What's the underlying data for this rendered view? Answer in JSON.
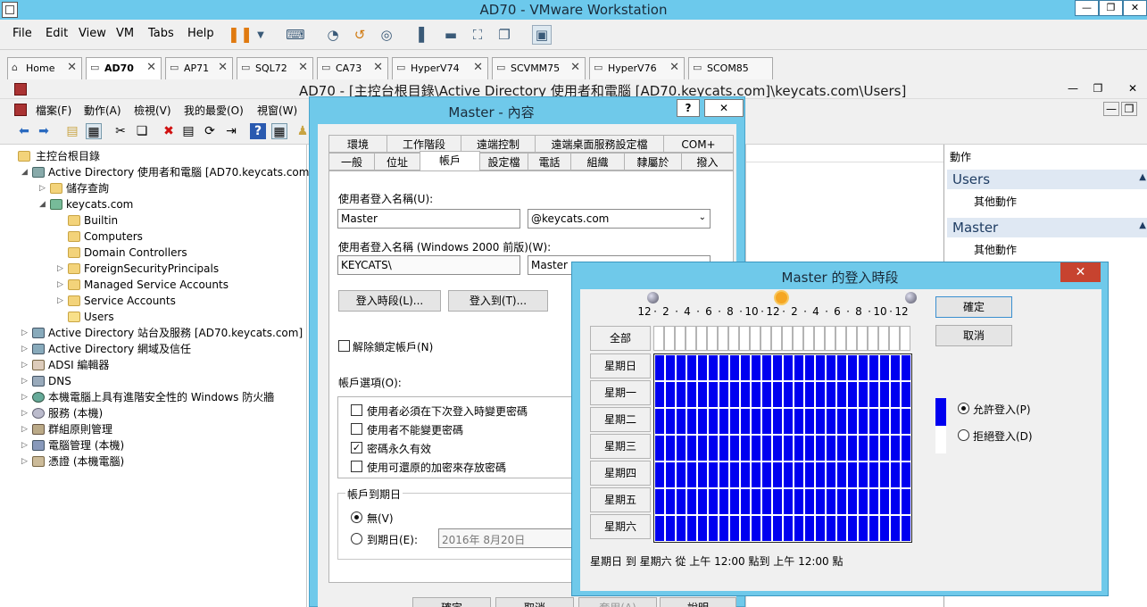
{
  "vmware": {
    "title": "AD70 - VMware Workstation",
    "menu": [
      "File",
      "Edit",
      "View",
      "VM",
      "Tabs",
      "Help"
    ],
    "tabs": [
      {
        "label": "Home",
        "icon": "home-icon",
        "active": false
      },
      {
        "label": "AD70",
        "icon": "vm-icon",
        "active": true
      },
      {
        "label": "AP71",
        "icon": "vm-icon",
        "active": false
      },
      {
        "label": "SQL72",
        "icon": "vm-icon",
        "active": false
      },
      {
        "label": "CA73",
        "icon": "vm-icon",
        "active": false
      },
      {
        "label": "HyperV74",
        "icon": "vm-icon",
        "active": false
      },
      {
        "label": "SCVMM75",
        "icon": "vm-icon",
        "active": false
      },
      {
        "label": "HyperV76",
        "icon": "vm-icon",
        "active": false
      },
      {
        "label": "SCOM85",
        "icon": "vm-icon",
        "active": false
      }
    ]
  },
  "mmc": {
    "title": "AD70 - [主控台根目錄\\Active Directory 使用者和電腦 [AD70.keycats.com]\\keycats.com\\Users]",
    "menu": [
      "檔案(F)",
      "動作(A)",
      "檢視(V)",
      "我的最愛(O)",
      "視窗(W)"
    ],
    "tree": [
      {
        "label": "主控台根目錄",
        "level": 0,
        "expander": ""
      },
      {
        "label": "Active Directory 使用者和電腦 [AD70.keycats.com]",
        "level": 1,
        "expander": "◢"
      },
      {
        "label": "儲存查詢",
        "level": 2,
        "expander": "▷"
      },
      {
        "label": "keycats.com",
        "level": 2,
        "expander": "◢"
      },
      {
        "label": "Builtin",
        "level": 3,
        "expander": ""
      },
      {
        "label": "Computers",
        "level": 3,
        "expander": ""
      },
      {
        "label": "Domain Controllers",
        "level": 3,
        "expander": ""
      },
      {
        "label": "ForeignSecurityPrincipals",
        "level": 3,
        "expander": "▷"
      },
      {
        "label": "Managed Service Accounts",
        "level": 3,
        "expander": "▷"
      },
      {
        "label": "Service Accounts",
        "level": 3,
        "expander": "▷"
      },
      {
        "label": "Users",
        "level": 3,
        "expander": ""
      },
      {
        "label": "Active Directory 站台及服務 [AD70.keycats.com]",
        "level": 0,
        "expander": "▷"
      },
      {
        "label": "Active Directory 網域及信任",
        "level": 0,
        "expander": "▷"
      },
      {
        "label": "ADSI 編輯器",
        "level": 0,
        "expander": "▷"
      },
      {
        "label": "DNS",
        "level": 0,
        "expander": "▷"
      },
      {
        "label": "本機電腦上具有進階安全性的 Windows 防火牆",
        "level": 0,
        "expander": "▷"
      },
      {
        "label": "服務 (本機)",
        "level": 0,
        "expander": "▷"
      },
      {
        "label": "群組原則管理",
        "level": 0,
        "expander": "▷"
      },
      {
        "label": "電腦管理 (本機)",
        "level": 0,
        "expander": "▷"
      },
      {
        "label": "憑證 (本機電腦)",
        "level": 0,
        "expander": "▷"
      }
    ],
    "actions": {
      "header": "動作",
      "sections": [
        {
          "title": "Users",
          "item": "其他動作"
        },
        {
          "title": "Master",
          "item": "其他動作"
        }
      ]
    }
  },
  "props": {
    "title": "Master - 內容",
    "help": "?",
    "close": "✕",
    "tabs_row1": [
      "環境",
      "工作階段",
      "遠端控制",
      "遠端桌面服務設定檔",
      "COM+"
    ],
    "tabs_row2": [
      "一般",
      "位址",
      "帳戶",
      "設定檔",
      "電話",
      "組織",
      "隸屬於",
      "撥入"
    ],
    "logon_name_label": "使用者登入名稱(U):",
    "logon_name": "Master",
    "domain_suffix": "@keycats.com",
    "pre2000_label": "使用者登入名稱 (Windows 2000 前版)(W):",
    "pre2000_domain": "KEYCATS\\",
    "pre2000_name": "Master",
    "logon_hours_button": "登入時段(L)...",
    "logon_to_button": "登入到(T)...",
    "unlock_label": "解除鎖定帳戶(N)",
    "options_label": "帳戶選項(O):",
    "options": [
      {
        "label": "使用者必須在下次登入時變更密碼",
        "checked": false
      },
      {
        "label": "使用者不能變更密碼",
        "checked": false
      },
      {
        "label": "密碼永久有效",
        "checked": true
      },
      {
        "label": "使用可還原的加密來存放密碼",
        "checked": false
      }
    ],
    "expires_label": "帳戶到期日",
    "never_label": "無(V)",
    "end_of_label": "到期日(E):",
    "end_date": "2016年  8月20日",
    "buttons": [
      "確定",
      "取消",
      "套用(A)",
      "說明"
    ]
  },
  "hours": {
    "title": "Master 的登入時段",
    "close": "✕",
    "time_labels": [
      "12",
      "2",
      "4",
      "6",
      "8",
      "10",
      "12",
      "2",
      "4",
      "6",
      "8",
      "10",
      "12"
    ],
    "all_label": "全部",
    "days": [
      "星期日",
      "星期一",
      "星期二",
      "星期三",
      "星期四",
      "星期五",
      "星期六"
    ],
    "ok": "確定",
    "cancel": "取消",
    "permit_label": "允許登入(P)",
    "deny_label": "拒絕登入(D)",
    "permit_color": "#0000f0",
    "deny_color": "#ffffff",
    "permitted_fraction": 1.0,
    "status": "星期日 到 星期六 從 上午 12:00 點到 上午 12:00 點"
  }
}
